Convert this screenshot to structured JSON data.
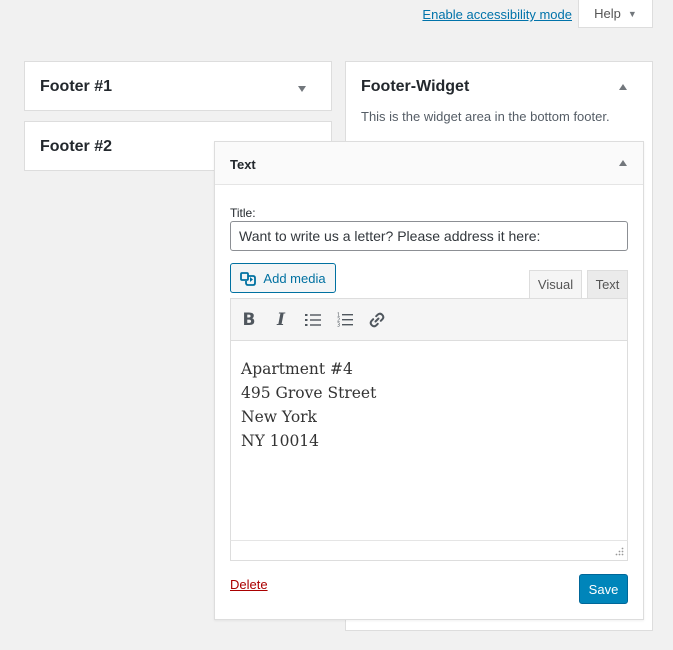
{
  "screen_options": {
    "accessibility_link": "Enable accessibility mode",
    "help_label": "Help"
  },
  "sidebars": {
    "footer1": {
      "name": "Footer #1"
    },
    "footer2": {
      "name": "Footer #2"
    },
    "footer_widget": {
      "name": "Footer-Widget",
      "description": "This is the widget area in the bottom footer."
    }
  },
  "widget": {
    "title": "Text",
    "title_label": "Title:",
    "title_value": "Want to write us a letter? Please address it here:",
    "add_media_label": "Add media",
    "tabs": {
      "visual": "Visual",
      "text": "Text"
    },
    "content_lines": [
      "Apartment #4",
      "495 Grove Street",
      "New York",
      "NY 10014"
    ],
    "delete_label": "Delete",
    "save_label": "Save"
  },
  "colors": {
    "link": "#0073aa",
    "primary_button": "#0085ba",
    "delete": "#aa0000"
  }
}
